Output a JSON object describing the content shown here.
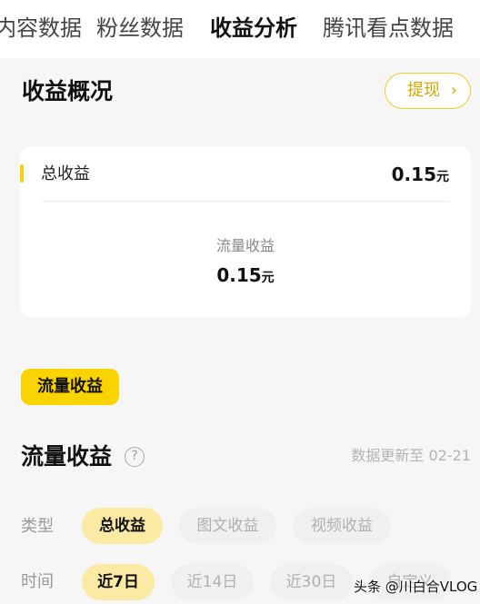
{
  "top_tabs": {
    "content": "内容数据",
    "fans": "粉丝数据",
    "income": "收益分析",
    "kandian": "腾讯看点数据"
  },
  "overview": {
    "title": "收益概况",
    "withdraw_label": "提现",
    "total_label": "总收益",
    "total_value": "0.15",
    "unit": "元",
    "flow_label": "流量收益",
    "flow_value": "0.15"
  },
  "flow_tag": "流量收益",
  "flow_section": {
    "title": "流量收益",
    "help_glyph": "?",
    "update_text": "数据更新至 02-21",
    "type_label": "类型",
    "type_options": [
      "总收益",
      "图文收益",
      "视频收益"
    ],
    "time_label": "时间",
    "time_options": [
      "近7日",
      "近14日",
      "近30日",
      "自定义"
    ]
  },
  "watermark": "头条 @川白合VLOG",
  "colors": {
    "accent": "#fad400",
    "chip_selected": "#fbeaa3",
    "withdraw": "#d9a800"
  }
}
